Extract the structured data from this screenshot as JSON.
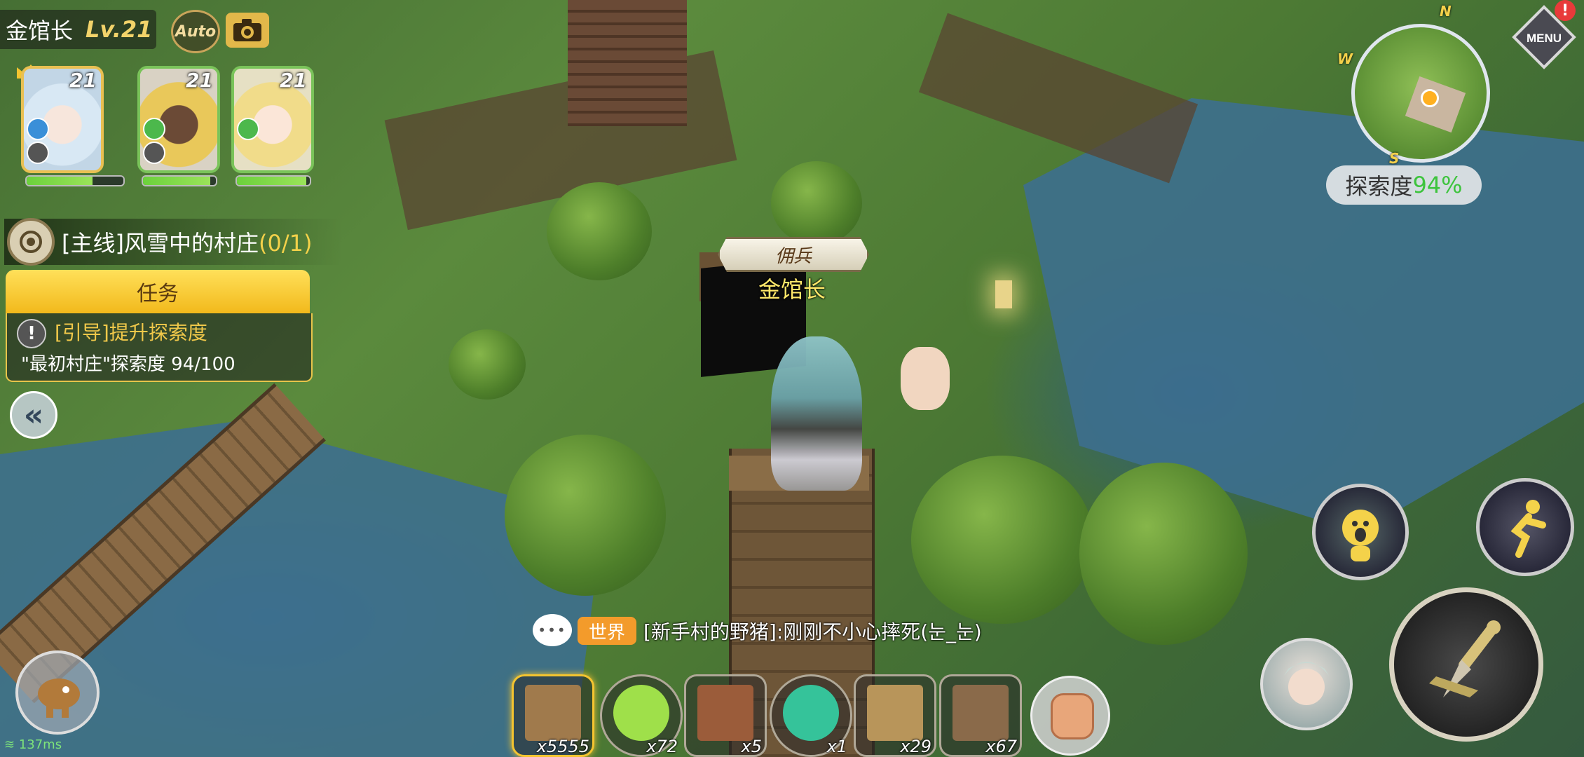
{
  "player": {
    "name": "金馆长",
    "level": "Lv.21"
  },
  "top_buttons": {
    "auto_label": "Auto"
  },
  "party": [
    {
      "level": "21",
      "hp": 0.68
    },
    {
      "level": "21",
      "hp": 0.92
    },
    {
      "level": "21",
      "hp": 0.95
    }
  ],
  "quest": {
    "title": "[主线]风雪中的村庄",
    "progress": "(0/1)",
    "tab_label": "任务",
    "line1": "[引导]提升探索度",
    "line2": "\"最初村庄\"探索度 94/100"
  },
  "character": {
    "role_tag": "佣兵",
    "name": "金馆长"
  },
  "minimap": {
    "compass_n": "N",
    "compass_w": "W",
    "compass_s": "S",
    "explore_label": "探索度",
    "explore_value": "94%"
  },
  "menu": {
    "label": "MENU",
    "badge": "!"
  },
  "chat": {
    "bubble": "•••",
    "channel": "世界",
    "message": "[新手村的野猪]:刚刚不小心摔死(눈_눈)"
  },
  "hotbar": [
    {
      "name": "wood-block",
      "count": "x5555",
      "color": "#a07a4c",
      "selected": true
    },
    {
      "name": "green-potion",
      "count": "x72",
      "color": "#9fe04a",
      "selected": false
    },
    {
      "name": "dirt-block",
      "count": "x5",
      "color": "#9b5c3a",
      "selected": false
    },
    {
      "name": "teal-potion",
      "count": "x1",
      "color": "#35c39a",
      "selected": false
    },
    {
      "name": "sand-block",
      "count": "x29",
      "color": "#b8955a",
      "selected": false
    },
    {
      "name": "plank-block",
      "count": "x67",
      "color": "#8a6a4a",
      "selected": false
    }
  ],
  "network": {
    "ping": "137ms"
  }
}
